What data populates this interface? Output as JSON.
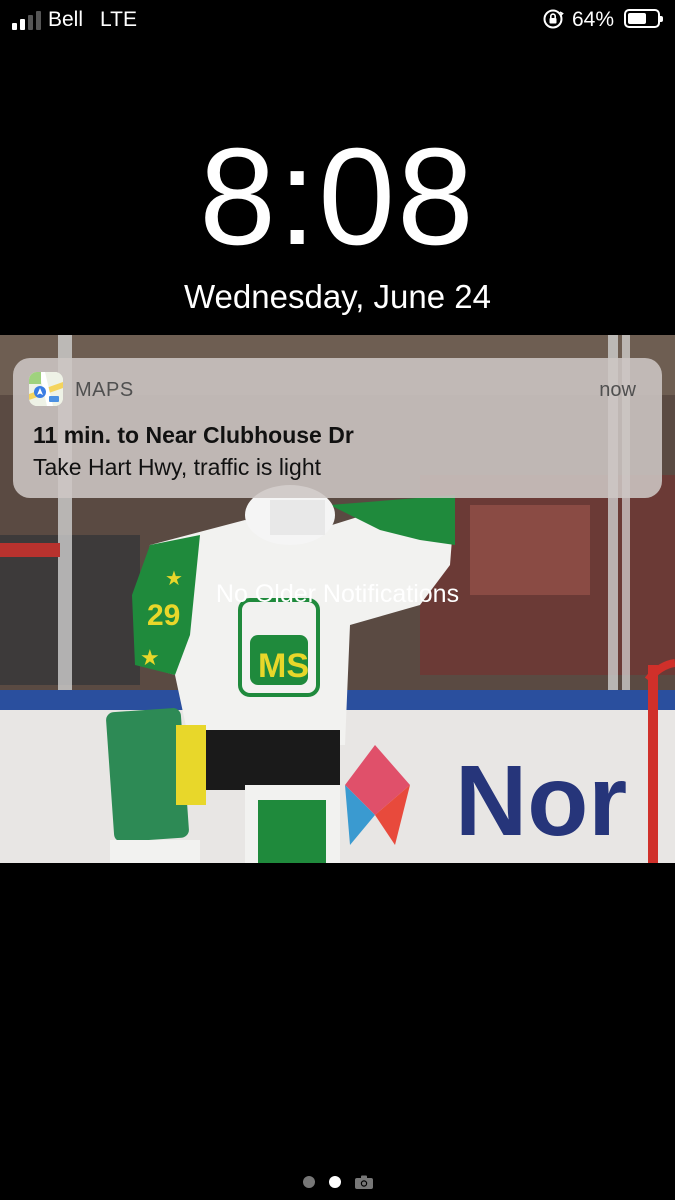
{
  "status_bar": {
    "carrier": "Bell",
    "network": "LTE",
    "battery_percent": "64%",
    "battery_level": 0.64,
    "signal_bars_active": 2,
    "signal_bars_total": 4
  },
  "lock_screen": {
    "time": "8:08",
    "date": "Wednesday, June 24"
  },
  "notification": {
    "app_name": "MAPS",
    "time": "now",
    "title": "11 min. to Near Clubhouse Dr",
    "body": "Take Hart Hwy, traffic is light",
    "app_icon": "maps-icon"
  },
  "no_older_label": "No Older Notifications",
  "page_indicator": {
    "pages": 2,
    "active_index": 1,
    "extra_icon": "camera-icon"
  },
  "colors": {
    "notification_bg": "#cdc6c4",
    "jersey_green": "#1f8a3c",
    "jersey_yellow": "#e8d72a",
    "rink_blue": "#2a4f9e"
  }
}
